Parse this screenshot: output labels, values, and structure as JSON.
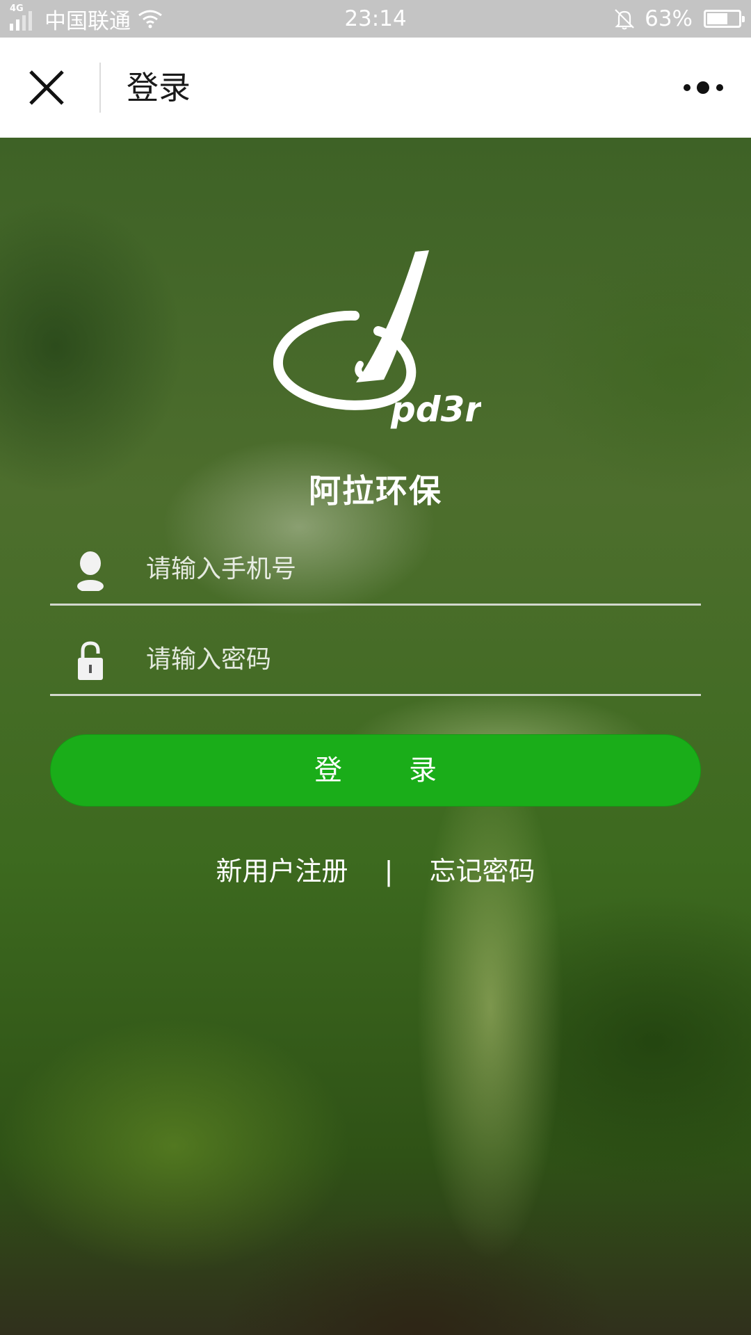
{
  "status_bar": {
    "network_type": "4G",
    "carrier": "中国联通",
    "time": "23:14",
    "battery_percent": "63%",
    "battery_level": 0.63
  },
  "nav": {
    "title": "登录"
  },
  "app": {
    "name": "阿拉环保",
    "brand_color": "#1aad19"
  },
  "form": {
    "phone_placeholder": "请输入手机号",
    "phone_value": "",
    "password_placeholder": "请输入密码",
    "password_value": "",
    "login_label": "登　录"
  },
  "links": {
    "register": "新用户注册",
    "separator": "|",
    "forgot": "忘记密码"
  }
}
